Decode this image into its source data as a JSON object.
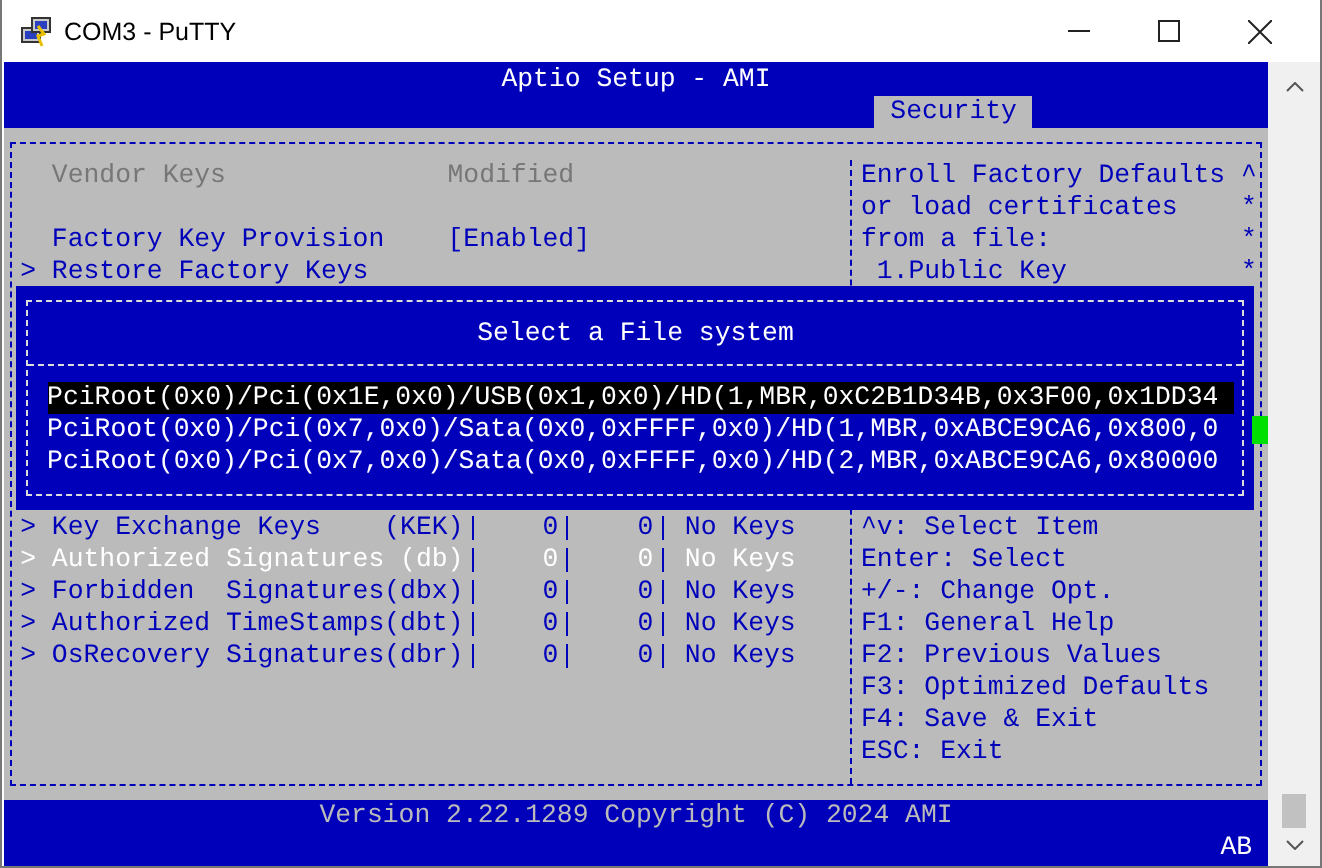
{
  "window": {
    "title": "COM3 - PuTTY"
  },
  "header": {
    "title": "Aptio Setup - AMI"
  },
  "tabs": [
    {
      "label": "Security",
      "selected": true
    }
  ],
  "settings": [
    {
      "kind": "value",
      "label": "Vendor Keys",
      "value": "Modified",
      "disabled": true
    },
    {
      "kind": "blank"
    },
    {
      "kind": "value",
      "label": "Factory Key Provision",
      "value": "[Enabled]",
      "disabled": false
    },
    {
      "kind": "submenu",
      "marker": ">",
      "label": "Restore Factory Keys",
      "disabled": false
    }
  ],
  "dialog": {
    "title": "Select a File system",
    "items": [
      {
        "label": "PciRoot(0x0)/Pci(0x1E,0x0)/USB(0x1,0x0)/HD(1,MBR,0xC2B1D34B,0x3F00,0x1DD34",
        "selected": true
      },
      {
        "label": "PciRoot(0x0)/Pci(0x7,0x0)/Sata(0x0,0xFFFF,0x0)/HD(1,MBR,0xABCE9CA6,0x800,0",
        "selected": false
      },
      {
        "label": "PciRoot(0x0)/Pci(0x7,0x0)/Sata(0x0,0xFFFF,0x0)/HD(2,MBR,0xABCE9CA6,0x80000",
        "selected": false
      }
    ]
  },
  "key_table": {
    "rows": [
      {
        "marker": ">",
        "name": "Key Exchange Keys    (KEK)",
        "column_2": "0",
        "column_3": "0",
        "status": "No Keys",
        "selected": false
      },
      {
        "marker": ">",
        "name": "Authorized Signatures (db)",
        "column_2": "0",
        "column_3": "0",
        "status": "No Keys",
        "selected": true
      },
      {
        "marker": ">",
        "name": "Forbidden  Signatures(dbx)",
        "column_2": "0",
        "column_3": "0",
        "status": "No Keys",
        "selected": false
      },
      {
        "marker": ">",
        "name": "Authorized TimeStamps(dbt)",
        "column_2": "0",
        "column_3": "0",
        "status": "No Keys",
        "selected": false
      },
      {
        "marker": ">",
        "name": "OsRecovery Signatures(dbr)",
        "column_2": "0",
        "column_3": "0",
        "status": "No Keys",
        "selected": false
      }
    ]
  },
  "help": {
    "description": [
      {
        "text": "Enroll Factory Defaults",
        "scroll_mark": "^"
      },
      {
        "text": "or load certificates",
        "scroll_mark": "*"
      },
      {
        "text": "from a file:",
        "scroll_mark": "*"
      },
      {
        "text": " 1.Public Key",
        "scroll_mark": "*"
      }
    ],
    "keys": [
      "^v: Select Item",
      "Enter: Select",
      "+/-: Change Opt.",
      "F1: General Help",
      "F2: Previous Values",
      "F3: Optimized Defaults",
      "F4: Save & Exit",
      "ESC: Exit"
    ]
  },
  "footer": {
    "version": "Version 2.22.1289 Copyright (C) 2024 AMI",
    "status": "AB"
  }
}
